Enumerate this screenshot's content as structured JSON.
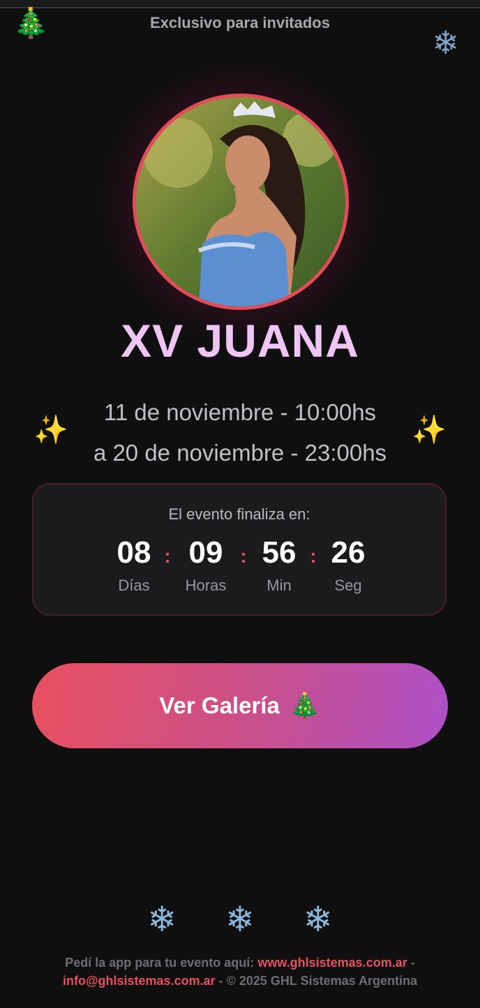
{
  "header": {
    "label": "Exclusivo para invitados",
    "left_icon": "christmas-tree-icon",
    "right_icon": "snowflake-icon"
  },
  "event": {
    "title": "XV JUANA",
    "date_line_1": "11 de noviembre - 10:00hs",
    "date_line_2": "a 20 de noviembre - 23:00hs",
    "sparkle_icon": "sparkles-icon"
  },
  "countdown": {
    "title": "El evento finaliza en:",
    "days": {
      "value": "08",
      "label": "Días"
    },
    "hours": {
      "value": "09",
      "label": "Horas"
    },
    "minutes": {
      "value": "56",
      "label": "Min"
    },
    "seconds": {
      "value": "26",
      "label": "Seg"
    },
    "separator": ":"
  },
  "gallery_button": {
    "label": "Ver Galería",
    "icon": "christmas-tree-icon"
  },
  "footer": {
    "text_before": "Pedí la app para tu evento aquí:",
    "website": "www.ghlsistemas.com.ar",
    "dash": "-",
    "email": "info@ghlsistemas.com.ar",
    "copyright": "- © 2025 GHL Sistemas Argentina"
  },
  "colors": {
    "background": "#0f0f10",
    "accent_red": "#e24b5a",
    "gradient_start": "#e8505f",
    "gradient_end": "#ad50c8",
    "title": "#efc6f3"
  }
}
